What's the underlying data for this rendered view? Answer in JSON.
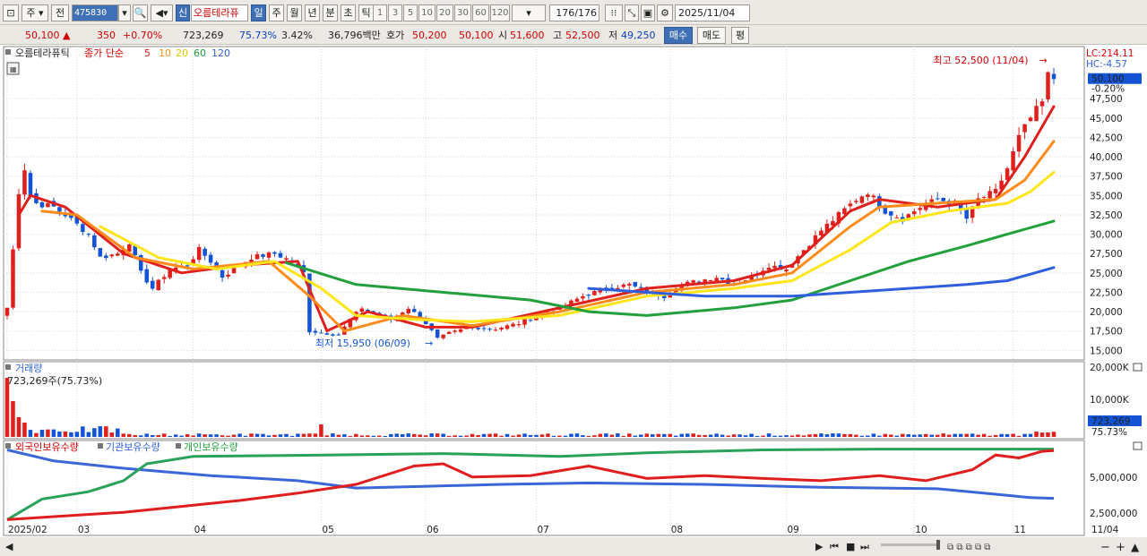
{
  "toolbar": {
    "period_label": "주",
    "prev_label": "전",
    "code": "475830",
    "new_badge": "신",
    "stock_name": "오름테라퓨",
    "periods": [
      "일",
      "주",
      "월",
      "년",
      "분",
      "초",
      "틱"
    ],
    "active_period": "일",
    "intervals": [
      "1",
      "3",
      "5",
      "10",
      "20",
      "30",
      "60",
      "120"
    ],
    "count": "176",
    "count_total": "/176",
    "date": "2025/11/04"
  },
  "quote": {
    "price": "50,100",
    "change_arrow": "▲",
    "change": "350",
    "change_pct": "+0.70%",
    "volume": "723,269",
    "volume_ratio": "75.73%",
    "turnover": "3.42%",
    "amount": "36,796백만",
    "ask_label": "호가",
    "ask1": "50,200",
    "ask2": "50,100",
    "open_label": "시",
    "open": "51,600",
    "high_label": "고",
    "high": "52,500",
    "low_label": "저",
    "low": "49,250",
    "buy_label": "매수",
    "sell_label": "매도",
    "avg_label": "평"
  },
  "colors": {
    "candle_up": "#e0201c",
    "candle_down": "#1454d4",
    "ma5": "#e0201c",
    "ma10": "#ff8c1a",
    "ma20": "#ffe61a",
    "ma60": "#21a03c",
    "ma120": "#2f5fdc",
    "foreign": "#3a66d8",
    "institution": "#2aa35a",
    "individual": "#e01e1e"
  },
  "chart_data": {
    "type": "candlestick",
    "price_panel": {
      "legend_stock": "오름테라퓨틱",
      "legend_ma": "종가 단순",
      "ma_periods": [
        "5",
        "10",
        "20",
        "60",
        "120"
      ],
      "top_right_lc": "LC:214.11",
      "top_right_hc": "HC:-4.57",
      "current_price_tag": "50,100",
      "current_change_tag": "-0.20%",
      "y_ticks": [
        "15,000",
        "17,500",
        "20,000",
        "22,500",
        "25,000",
        "27,500",
        "30,000",
        "32,500",
        "35,000",
        "37,500",
        "40,000",
        "42,500",
        "45,000",
        "47,500"
      ],
      "ylim": [
        14000,
        54000
      ],
      "high_annotation": "최고 52,500 (11/04)",
      "low_annotation": "최저 15,950 (06/09)"
    },
    "x_labels": [
      {
        "label": "2025/02",
        "index": 0
      },
      {
        "label": "03",
        "index": 12
      },
      {
        "label": "04",
        "index": 32
      },
      {
        "label": "05",
        "index": 54
      },
      {
        "label": "06",
        "index": 72
      },
      {
        "label": "07",
        "index": 91
      },
      {
        "label": "08",
        "index": 114
      },
      {
        "label": "09",
        "index": 134
      },
      {
        "label": "10",
        "index": 156
      },
      {
        "label": "11",
        "index": 173
      }
    ],
    "x_end_label": "11/04",
    "anchors": [
      [
        0,
        20500,
        1
      ],
      [
        1,
        28000,
        1
      ],
      [
        2,
        35500,
        1
      ],
      [
        3,
        38500,
        1
      ],
      [
        4,
        35000,
        0
      ],
      [
        5,
        34000,
        0
      ],
      [
        8,
        33500,
        1
      ],
      [
        10,
        32500,
        0
      ],
      [
        14,
        30000,
        0
      ],
      [
        16,
        27000,
        0
      ],
      [
        19,
        27500,
        1
      ],
      [
        21,
        29000,
        1
      ],
      [
        23,
        25000,
        0
      ],
      [
        25,
        23000,
        0
      ],
      [
        28,
        25500,
        1
      ],
      [
        31,
        26000,
        1
      ],
      [
        33,
        28000,
        1
      ],
      [
        35,
        26500,
        0
      ],
      [
        37,
        24500,
        0
      ],
      [
        39,
        25500,
        1
      ],
      [
        42,
        27000,
        1
      ],
      [
        46,
        27500,
        1
      ],
      [
        49,
        26500,
        0
      ],
      [
        51,
        25000,
        0
      ],
      [
        52,
        17500,
        0
      ],
      [
        54,
        17300,
        0
      ],
      [
        57,
        17000,
        0
      ],
      [
        59,
        19000,
        1
      ],
      [
        61,
        20500,
        1
      ],
      [
        63,
        20000,
        0
      ],
      [
        66,
        19000,
        0
      ],
      [
        69,
        20500,
        1
      ],
      [
        72,
        18500,
        0
      ],
      [
        74,
        16500,
        0
      ],
      [
        76,
        17200,
        1
      ],
      [
        80,
        18000,
        1
      ],
      [
        84,
        17800,
        0
      ],
      [
        88,
        18500,
        1
      ],
      [
        91,
        19500,
        1
      ],
      [
        95,
        20500,
        1
      ],
      [
        99,
        22000,
        1
      ],
      [
        103,
        23000,
        1
      ],
      [
        107,
        23500,
        1
      ],
      [
        110,
        22500,
        0
      ],
      [
        113,
        22000,
        0
      ],
      [
        116,
        23500,
        1
      ],
      [
        119,
        24000,
        1
      ],
      [
        122,
        24500,
        1
      ],
      [
        125,
        23500,
        0
      ],
      [
        128,
        24500,
        1
      ],
      [
        131,
        26000,
        1
      ],
      [
        134,
        25500,
        0
      ],
      [
        137,
        28000,
        1
      ],
      [
        140,
        30500,
        1
      ],
      [
        143,
        32500,
        1
      ],
      [
        146,
        34500,
        1
      ],
      [
        148,
        35500,
        1
      ],
      [
        151,
        33000,
        0
      ],
      [
        154,
        32000,
        0
      ],
      [
        157,
        33500,
        1
      ],
      [
        160,
        34500,
        1
      ],
      [
        163,
        34000,
        0
      ],
      [
        165,
        32000,
        0
      ],
      [
        167,
        34500,
        1
      ],
      [
        170,
        35500,
        1
      ],
      [
        172,
        38500,
        1
      ],
      [
        174,
        42500,
        1
      ],
      [
        176,
        45000,
        1
      ],
      [
        178,
        47000,
        1
      ],
      [
        179,
        50500,
        1
      ],
      [
        180,
        50100,
        1
      ]
    ],
    "ma_series": [
      {
        "name": "5",
        "points": [
          [
            2,
            32500
          ],
          [
            4,
            35000
          ],
          [
            10,
            33500
          ],
          [
            20,
            27500
          ],
          [
            30,
            25000
          ],
          [
            40,
            26000
          ],
          [
            50,
            26500
          ],
          [
            55,
            17500
          ],
          [
            62,
            20000
          ],
          [
            72,
            18000
          ],
          [
            80,
            18000
          ],
          [
            95,
            20500
          ],
          [
            110,
            23000
          ],
          [
            125,
            24000
          ],
          [
            135,
            26000
          ],
          [
            145,
            33000
          ],
          [
            150,
            34500
          ],
          [
            160,
            33500
          ],
          [
            170,
            34500
          ],
          [
            175,
            40000
          ],
          [
            180,
            46500
          ]
        ]
      },
      {
        "name": "10",
        "points": [
          [
            6,
            33000
          ],
          [
            12,
            32500
          ],
          [
            22,
            27000
          ],
          [
            32,
            25500
          ],
          [
            45,
            26500
          ],
          [
            52,
            22000
          ],
          [
            58,
            17500
          ],
          [
            68,
            19500
          ],
          [
            80,
            18200
          ],
          [
            95,
            20000
          ],
          [
            110,
            22500
          ],
          [
            125,
            23500
          ],
          [
            135,
            25000
          ],
          [
            145,
            31000
          ],
          [
            150,
            33500
          ],
          [
            160,
            34000
          ],
          [
            170,
            34500
          ],
          [
            175,
            37000
          ],
          [
            180,
            42000
          ]
        ]
      },
      {
        "name": "20",
        "points": [
          [
            16,
            31000
          ],
          [
            26,
            27000
          ],
          [
            36,
            25500
          ],
          [
            46,
            26500
          ],
          [
            54,
            23000
          ],
          [
            60,
            19500
          ],
          [
            70,
            19000
          ],
          [
            80,
            18700
          ],
          [
            95,
            19500
          ],
          [
            110,
            22000
          ],
          [
            125,
            23000
          ],
          [
            135,
            24000
          ],
          [
            145,
            28000
          ],
          [
            152,
            31500
          ],
          [
            162,
            33000
          ],
          [
            172,
            34000
          ],
          [
            176,
            35500
          ],
          [
            180,
            38000
          ]
        ]
      },
      {
        "name": "60",
        "points": [
          [
            48,
            26300
          ],
          [
            60,
            23500
          ],
          [
            75,
            22500
          ],
          [
            90,
            21500
          ],
          [
            100,
            20000
          ],
          [
            110,
            19500
          ],
          [
            125,
            20500
          ],
          [
            135,
            21500
          ],
          [
            145,
            24000
          ],
          [
            155,
            26500
          ],
          [
            165,
            28500
          ],
          [
            172,
            30000
          ],
          [
            180,
            31700
          ]
        ]
      },
      {
        "name": "120",
        "points": [
          [
            100,
            23000
          ],
          [
            110,
            22500
          ],
          [
            120,
            22000
          ],
          [
            135,
            22000
          ],
          [
            145,
            22500
          ],
          [
            155,
            23000
          ],
          [
            165,
            23500
          ],
          [
            172,
            24000
          ],
          [
            180,
            25700
          ]
        ]
      }
    ],
    "volume_panel": {
      "label": "거래량",
      "annotation": "723,269주(75.73%)",
      "y_ticks": [
        "10,000K",
        "20,000K"
      ],
      "current_tag": "723,269",
      "current_pct": "75.73%"
    },
    "holdings_panel": {
      "series_labels": [
        "외국인보유수량",
        "기관보유수량",
        "개인보유수량"
      ],
      "y_ticks": [
        "2,500,000",
        "5,000,000"
      ]
    }
  }
}
